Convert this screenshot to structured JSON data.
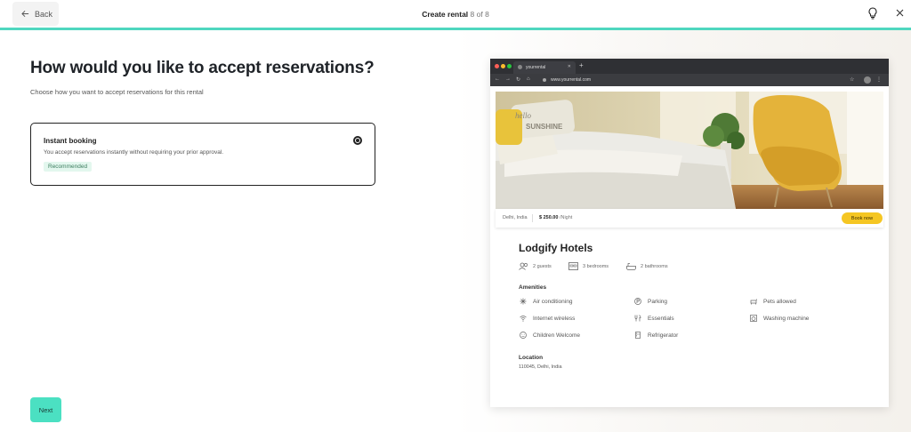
{
  "header": {
    "back_label": "Back",
    "title_bold": "Create rental",
    "title_step": "8 of 8"
  },
  "main": {
    "heading": "How would you like to accept reservations?",
    "subheading": "Choose how you want to accept reservations for this rental",
    "option": {
      "title": "Instant booking",
      "description": "You accept reservations instantly without requiring your prior approval.",
      "badge": "Recommended"
    },
    "next_label": "Next"
  },
  "preview": {
    "browser": {
      "tab_title": "yourrental",
      "url": "www.yourrental.com"
    },
    "hero": {
      "pillow_text_1": "hello",
      "pillow_text_2": "SUNSHINE"
    },
    "price_bar": {
      "city": "Delhi, India",
      "price": "$ 250.00",
      "per": "/Night",
      "book_label": "Book now"
    },
    "hotel_name": "Lodgify Hotels",
    "features": [
      {
        "icon": "guests-icon",
        "label": "2 guests"
      },
      {
        "icon": "bedroom-icon",
        "label": "3 bedrooms"
      },
      {
        "icon": "bathroom-icon",
        "label": "2 bathrooms"
      }
    ],
    "amenities_title": "Amenities",
    "amenities": [
      {
        "icon": "air-conditioning-icon",
        "label": "Air conditioning"
      },
      {
        "icon": "parking-icon",
        "label": "Parking"
      },
      {
        "icon": "pets-icon",
        "label": "Pets allowed"
      },
      {
        "icon": "wifi-icon",
        "label": "Internet wireless"
      },
      {
        "icon": "essentials-icon",
        "label": "Essentials"
      },
      {
        "icon": "washing-machine-icon",
        "label": "Washing machine"
      },
      {
        "icon": "children-icon",
        "label": "Children Welcome"
      },
      {
        "icon": "refrigerator-icon",
        "label": "Refrigerator"
      }
    ],
    "location_title": "Location",
    "location_text": "110045, Delhi, India"
  },
  "colors": {
    "accent": "#4fd7bf",
    "next_button": "#4be0c2",
    "book_button": "#f5c623",
    "badge_bg": "#e3f7ee"
  }
}
